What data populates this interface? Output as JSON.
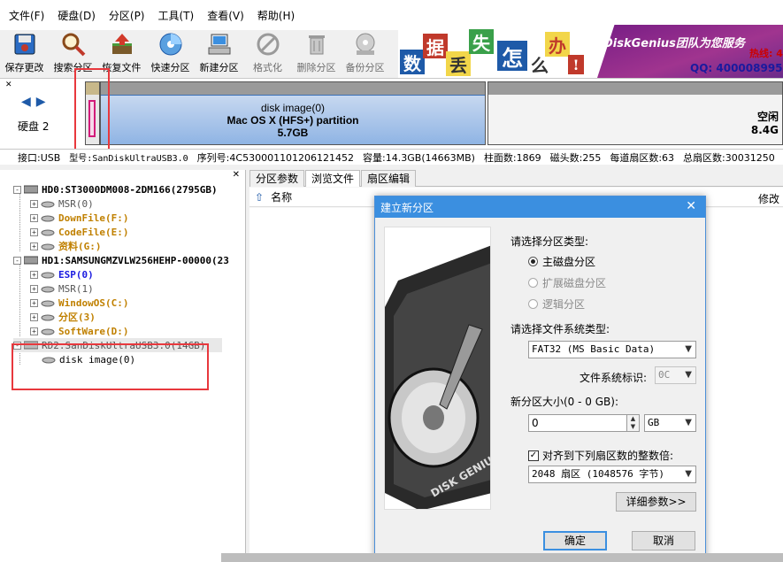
{
  "menu": [
    "文件(F)",
    "硬盘(D)",
    "分区(P)",
    "工具(T)",
    "查看(V)",
    "帮助(H)"
  ],
  "toolbar": [
    {
      "label": "保存更改",
      "icon": "save-icon",
      "enabled": true
    },
    {
      "label": "搜索分区",
      "icon": "search-icon",
      "enabled": true
    },
    {
      "label": "恢复文件",
      "icon": "recover-icon",
      "enabled": true
    },
    {
      "label": "快速分区",
      "icon": "quick-partition-icon",
      "enabled": true
    },
    {
      "label": "新建分区",
      "icon": "new-partition-icon",
      "enabled": true
    },
    {
      "label": "格式化",
      "icon": "format-icon",
      "enabled": false
    },
    {
      "label": "删除分区",
      "icon": "delete-partition-icon",
      "enabled": false
    },
    {
      "label": "备份分区",
      "icon": "backup-partition-icon",
      "enabled": false
    }
  ],
  "banner": {
    "chars": [
      "数",
      "据",
      "丢",
      "失",
      "怎",
      "么",
      "办",
      "!"
    ],
    "brand": "DiskGenius团队为您服务",
    "slogan": "热线: 400-",
    "qq": "QQ: 4000089958"
  },
  "disk_strip": {
    "disk_label": "硬盘 2",
    "partition_name": "disk image(0)",
    "partition_type": "Mac OS X (HFS+) partition",
    "partition_size": "5.7GB",
    "free_label": "空闲",
    "free_size": "8.4G"
  },
  "infobar": {
    "interface": "接口:USB",
    "model": "型号:SanDiskUltraUSB3.0",
    "serial": "序列号:4C530001101206121452",
    "capacity": "容量:14.3GB(14663MB)",
    "cylinders": "柱面数:1869",
    "heads": "磁头数:255",
    "sectors_per_track": "每道扇区数:63",
    "total_sectors": "总扇区数:30031250"
  },
  "tree": [
    {
      "text": "HD0:ST3000DM008-2DM166(2795GB)",
      "level": 0,
      "color": "black",
      "expander": "-"
    },
    {
      "text": "MSR(0)",
      "level": 1,
      "color": "gray",
      "expander": "+"
    },
    {
      "text": "DownFile(F:)",
      "level": 1,
      "color": "orange",
      "expander": "+"
    },
    {
      "text": "CodeFile(E:)",
      "level": 1,
      "color": "orange",
      "expander": "+"
    },
    {
      "text": "资料(G:)",
      "level": 1,
      "color": "orange",
      "expander": "+"
    },
    {
      "text": "HD1:SAMSUNGMZVLW256HEHP-00000(23",
      "level": 0,
      "color": "black",
      "expander": "-"
    },
    {
      "text": "ESP(0)",
      "level": 1,
      "color": "blue",
      "expander": "+"
    },
    {
      "text": "MSR(1)",
      "level": 1,
      "color": "gray",
      "expander": "+"
    },
    {
      "text": "WindowOS(C:)",
      "level": 1,
      "color": "orange",
      "expander": "+"
    },
    {
      "text": "分区(3)",
      "level": 1,
      "color": "orange",
      "expander": "+"
    },
    {
      "text": "SoftWare(D:)",
      "level": 1,
      "color": "orange",
      "expander": "+"
    },
    {
      "text": "RD2:SanDiskUltraUSB3.0(14GB)",
      "level": 0,
      "color": "gray",
      "expander": "-"
    },
    {
      "text": "disk image(0)",
      "level": 1,
      "color": "black",
      "expander": ""
    }
  ],
  "tabs": [
    "分区参数",
    "浏览文件",
    "扇区编辑"
  ],
  "active_tab": 1,
  "file_header": {
    "name": "名称",
    "modified": "修改"
  },
  "dialog": {
    "title": "建立新分区",
    "partition_type_prompt": "请选择分区类型:",
    "radio_primary": "主磁盘分区",
    "radio_extended": "扩展磁盘分区",
    "radio_logical": "逻辑分区",
    "fs_prompt": "请选择文件系统类型:",
    "fs_value": "FAT32 (MS Basic Data)",
    "fs_id_label": "文件系统标识:",
    "fs_id_value": "0C",
    "size_label": "新分区大小(0 - 0 GB):",
    "size_value": "0",
    "size_unit": "GB",
    "align_label": "对齐到下列扇区数的整数倍:",
    "align_value": "2048 扇区 (1048576 字节)",
    "advanced_button": "详细参数>>",
    "ok_button": "确定",
    "cancel_button": "取消",
    "image_text": "DISK GENIUS"
  }
}
